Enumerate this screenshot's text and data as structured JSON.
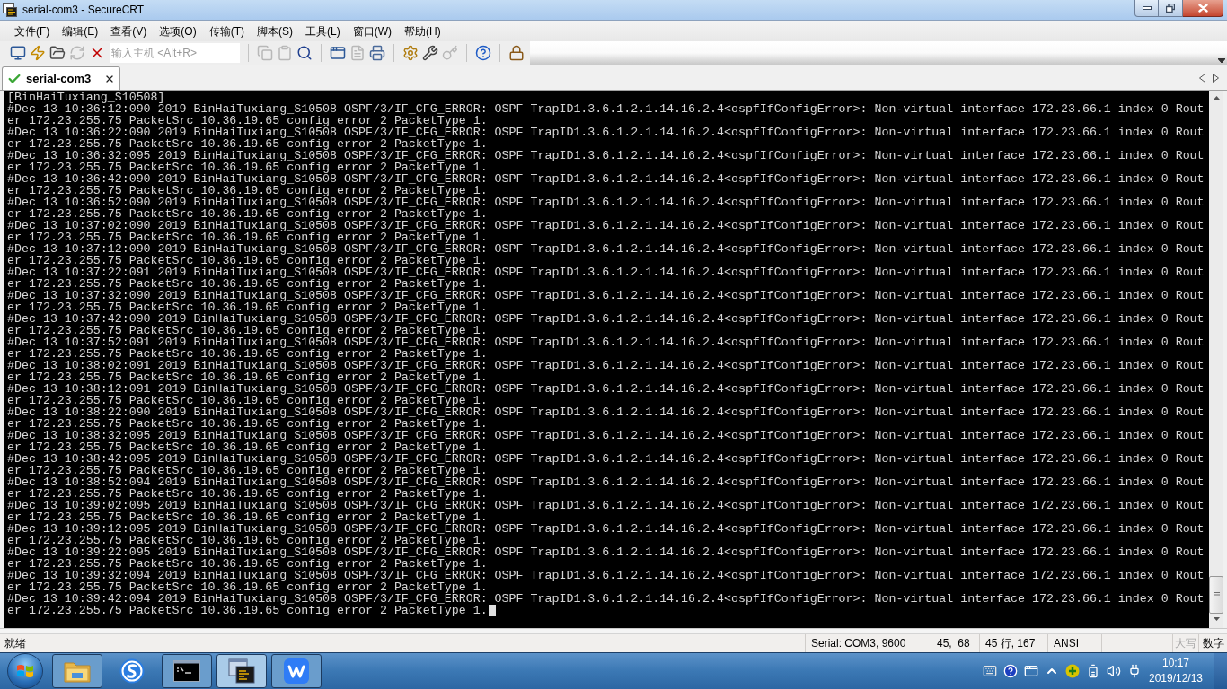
{
  "window": {
    "title": "serial-com3 - SecureCRT"
  },
  "menu": [
    "文件(F)",
    "编辑(E)",
    "查看(V)",
    "选项(O)",
    "传输(T)",
    "脚本(S)",
    "工具(L)",
    "窗口(W)",
    "帮助(H)"
  ],
  "toolbar": {
    "session_buttons": [
      {
        "disabled": false
      },
      {
        "disabled": false
      },
      {
        "disabled": false
      },
      {
        "disabled": true
      },
      {
        "disabled": false
      }
    ],
    "host_field": {
      "placeholder": "输入主机 <Alt+R>"
    },
    "button_groups": [
      [
        {
          "disabled": true
        },
        {
          "disabled": true
        },
        {
          "disabled": false
        }
      ],
      [
        {
          "disabled": false
        },
        {
          "disabled": true
        },
        {
          "disabled": false
        }
      ],
      [
        {
          "disabled": false
        },
        {
          "disabled": false
        },
        {
          "disabled": true
        }
      ],
      [
        {
          "disabled": false
        }
      ],
      [
        {
          "disabled": false
        }
      ]
    ]
  },
  "tabs": [
    {
      "label": "serial-com3",
      "selected": true,
      "connected": true
    }
  ],
  "terminal": {
    "lines": [
      "[BinHaiTuxiang_S10508]",
      "#Dec 13 10:36:12:090 2019 BinHaiTuxiang_S10508 OSPF/3/IF_CFG_ERROR: OSPF TrapID1.3.6.1.2.1.14.16.2.4<ospfIfConfigError>: Non-virtual interface 172.23.66.1 index 0 Rout",
      "er 172.23.255.75 PacketSrc 10.36.19.65 config error 2 PacketType 1.",
      "#Dec 13 10:36:22:090 2019 BinHaiTuxiang_S10508 OSPF/3/IF_CFG_ERROR: OSPF TrapID1.3.6.1.2.1.14.16.2.4<ospfIfConfigError>: Non-virtual interface 172.23.66.1 index 0 Rout",
      "er 172.23.255.75 PacketSrc 10.36.19.65 config error 2 PacketType 1.",
      "#Dec 13 10:36:32:095 2019 BinHaiTuxiang_S10508 OSPF/3/IF_CFG_ERROR: OSPF TrapID1.3.6.1.2.1.14.16.2.4<ospfIfConfigError>: Non-virtual interface 172.23.66.1 index 0 Rout",
      "er 172.23.255.75 PacketSrc 10.36.19.65 config error 2 PacketType 1.",
      "#Dec 13 10:36:42:090 2019 BinHaiTuxiang_S10508 OSPF/3/IF_CFG_ERROR: OSPF TrapID1.3.6.1.2.1.14.16.2.4<ospfIfConfigError>: Non-virtual interface 172.23.66.1 index 0 Rout",
      "er 172.23.255.75 PacketSrc 10.36.19.65 config error 2 PacketType 1.",
      "#Dec 13 10:36:52:090 2019 BinHaiTuxiang_S10508 OSPF/3/IF_CFG_ERROR: OSPF TrapID1.3.6.1.2.1.14.16.2.4<ospfIfConfigError>: Non-virtual interface 172.23.66.1 index 0 Rout",
      "er 172.23.255.75 PacketSrc 10.36.19.65 config error 2 PacketType 1.",
      "#Dec 13 10:37:02:090 2019 BinHaiTuxiang_S10508 OSPF/3/IF_CFG_ERROR: OSPF TrapID1.3.6.1.2.1.14.16.2.4<ospfIfConfigError>: Non-virtual interface 172.23.66.1 index 0 Rout",
      "er 172.23.255.75 PacketSrc 10.36.19.65 config error 2 PacketType 1.",
      "#Dec 13 10:37:12:090 2019 BinHaiTuxiang_S10508 OSPF/3/IF_CFG_ERROR: OSPF TrapID1.3.6.1.2.1.14.16.2.4<ospfIfConfigError>: Non-virtual interface 172.23.66.1 index 0 Rout",
      "er 172.23.255.75 PacketSrc 10.36.19.65 config error 2 PacketType 1.",
      "#Dec 13 10:37:22:091 2019 BinHaiTuxiang_S10508 OSPF/3/IF_CFG_ERROR: OSPF TrapID1.3.6.1.2.1.14.16.2.4<ospfIfConfigError>: Non-virtual interface 172.23.66.1 index 0 Rout",
      "er 172.23.255.75 PacketSrc 10.36.19.65 config error 2 PacketType 1.",
      "#Dec 13 10:37:32:090 2019 BinHaiTuxiang_S10508 OSPF/3/IF_CFG_ERROR: OSPF TrapID1.3.6.1.2.1.14.16.2.4<ospfIfConfigError>: Non-virtual interface 172.23.66.1 index 0 Rout",
      "er 172.23.255.75 PacketSrc 10.36.19.65 config error 2 PacketType 1.",
      "#Dec 13 10:37:42:090 2019 BinHaiTuxiang_S10508 OSPF/3/IF_CFG_ERROR: OSPF TrapID1.3.6.1.2.1.14.16.2.4<ospfIfConfigError>: Non-virtual interface 172.23.66.1 index 0 Rout",
      "er 172.23.255.75 PacketSrc 10.36.19.65 config error 2 PacketType 1.",
      "#Dec 13 10:37:52:091 2019 BinHaiTuxiang_S10508 OSPF/3/IF_CFG_ERROR: OSPF TrapID1.3.6.1.2.1.14.16.2.4<ospfIfConfigError>: Non-virtual interface 172.23.66.1 index 0 Rout",
      "er 172.23.255.75 PacketSrc 10.36.19.65 config error 2 PacketType 1.",
      "#Dec 13 10:38:02:091 2019 BinHaiTuxiang_S10508 OSPF/3/IF_CFG_ERROR: OSPF TrapID1.3.6.1.2.1.14.16.2.4<ospfIfConfigError>: Non-virtual interface 172.23.66.1 index 0 Rout",
      "er 172.23.255.75 PacketSrc 10.36.19.65 config error 2 PacketType 1.",
      "#Dec 13 10:38:12:091 2019 BinHaiTuxiang_S10508 OSPF/3/IF_CFG_ERROR: OSPF TrapID1.3.6.1.2.1.14.16.2.4<ospfIfConfigError>: Non-virtual interface 172.23.66.1 index 0 Rout",
      "er 172.23.255.75 PacketSrc 10.36.19.65 config error 2 PacketType 1.",
      "#Dec 13 10:38:22:090 2019 BinHaiTuxiang_S10508 OSPF/3/IF_CFG_ERROR: OSPF TrapID1.3.6.1.2.1.14.16.2.4<ospfIfConfigError>: Non-virtual interface 172.23.66.1 index 0 Rout",
      "er 172.23.255.75 PacketSrc 10.36.19.65 config error 2 PacketType 1.",
      "#Dec 13 10:38:32:095 2019 BinHaiTuxiang_S10508 OSPF/3/IF_CFG_ERROR: OSPF TrapID1.3.6.1.2.1.14.16.2.4<ospfIfConfigError>: Non-virtual interface 172.23.66.1 index 0 Rout",
      "er 172.23.255.75 PacketSrc 10.36.19.65 config error 2 PacketType 1.",
      "#Dec 13 10:38:42:095 2019 BinHaiTuxiang_S10508 OSPF/3/IF_CFG_ERROR: OSPF TrapID1.3.6.1.2.1.14.16.2.4<ospfIfConfigError>: Non-virtual interface 172.23.66.1 index 0 Rout",
      "er 172.23.255.75 PacketSrc 10.36.19.65 config error 2 PacketType 1.",
      "#Dec 13 10:38:52:094 2019 BinHaiTuxiang_S10508 OSPF/3/IF_CFG_ERROR: OSPF TrapID1.3.6.1.2.1.14.16.2.4<ospfIfConfigError>: Non-virtual interface 172.23.66.1 index 0 Rout",
      "er 172.23.255.75 PacketSrc 10.36.19.65 config error 2 PacketType 1.",
      "#Dec 13 10:39:02:095 2019 BinHaiTuxiang_S10508 OSPF/3/IF_CFG_ERROR: OSPF TrapID1.3.6.1.2.1.14.16.2.4<ospfIfConfigError>: Non-virtual interface 172.23.66.1 index 0 Rout",
      "er 172.23.255.75 PacketSrc 10.36.19.65 config error 2 PacketType 1.",
      "#Dec 13 10:39:12:095 2019 BinHaiTuxiang_S10508 OSPF/3/IF_CFG_ERROR: OSPF TrapID1.3.6.1.2.1.14.16.2.4<ospfIfConfigError>: Non-virtual interface 172.23.66.1 index 0 Rout",
      "er 172.23.255.75 PacketSrc 10.36.19.65 config error 2 PacketType 1.",
      "#Dec 13 10:39:22:095 2019 BinHaiTuxiang_S10508 OSPF/3/IF_CFG_ERROR: OSPF TrapID1.3.6.1.2.1.14.16.2.4<ospfIfConfigError>: Non-virtual interface 172.23.66.1 index 0 Rout",
      "er 172.23.255.75 PacketSrc 10.36.19.65 config error 2 PacketType 1.",
      "#Dec 13 10:39:32:094 2019 BinHaiTuxiang_S10508 OSPF/3/IF_CFG_ERROR: OSPF TrapID1.3.6.1.2.1.14.16.2.4<ospfIfConfigError>: Non-virtual interface 172.23.66.1 index 0 Rout",
      "er 172.23.255.75 PacketSrc 10.36.19.65 config error 2 PacketType 1.",
      "#Dec 13 10:39:42:094 2019 BinHaiTuxiang_S10508 OSPF/3/IF_CFG_ERROR: OSPF TrapID1.3.6.1.2.1.14.16.2.4<ospfIfConfigError>: Non-virtual interface 172.23.66.1 index 0 Rout",
      "er 172.23.255.75 PacketSrc 10.36.19.65 config error 2 PacketType 1."
    ],
    "cursor": true
  },
  "status_bar": {
    "message": "就绪",
    "connection": "Serial: COM3, 9600",
    "cursor_position": "45,  68",
    "size": "45 行, 167",
    "encoding": "ANSI",
    "indicators": [
      {
        "label": "大写",
        "on": false
      },
      {
        "label": "数字",
        "on": true
      }
    ]
  },
  "taskbar": {
    "apps": [
      {
        "running": true,
        "selected": false
      },
      {
        "running": false,
        "selected": false
      },
      {
        "running": true,
        "selected": false
      },
      {
        "running": true,
        "selected": true
      },
      {
        "running": true,
        "selected": false
      }
    ],
    "clock": {
      "time": "10:17",
      "date": "2019/12/13"
    }
  }
}
